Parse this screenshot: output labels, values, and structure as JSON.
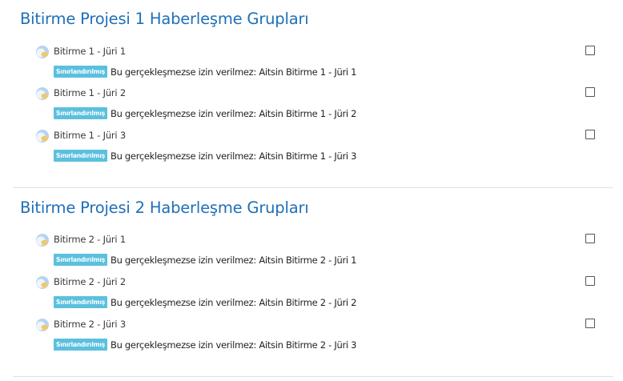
{
  "sections": [
    {
      "title": "Bitirme Projesi 1 Haberleşme Grupları",
      "activities": [
        {
          "name": "Bitirme 1 - Jüri 1",
          "badge": "Sınırlandırılmış",
          "restriction": "Bu gerçekleşmezse izin verilmez: Aitsin Bitirme 1 - Jüri 1"
        },
        {
          "name": "Bitirme 1 - Jüri 2",
          "badge": "Sınırlandırılmış",
          "restriction": "Bu gerçekleşmezse izin verilmez: Aitsin Bitirme 1 - Jüri 2"
        },
        {
          "name": "Bitirme 1 - Jüri 3",
          "badge": "Sınırlandırılmış",
          "restriction": "Bu gerçekleşmezse izin verilmez: Aitsin Bitirme 1 - Jüri 3"
        }
      ]
    },
    {
      "title": "Bitirme Projesi 2 Haberleşme Grupları",
      "activities": [
        {
          "name": "Bitirme 2 - Jüri 1",
          "badge": "Sınırlandırılmış",
          "restriction": "Bu gerçekleşmezse izin verilmez: Aitsin Bitirme 2 - Jüri 1"
        },
        {
          "name": "Bitirme 2 - Jüri 2",
          "badge": "Sınırlandırılmış",
          "restriction": "Bu gerçekleşmezse izin verilmez: Aitsin Bitirme 2 - Jüri 2"
        },
        {
          "name": "Bitirme 2 - Jüri 3",
          "badge": "Sınırlandırılmış",
          "restriction": "Bu gerçekleşmezse izin verilmez: Aitsin Bitirme 2 - Jüri 3"
        }
      ]
    }
  ],
  "icons": {
    "activity": "chat-icon",
    "completion": "checkbox-icon"
  },
  "colors": {
    "title": "#1f6fb8",
    "badge": "#5bc0de"
  }
}
